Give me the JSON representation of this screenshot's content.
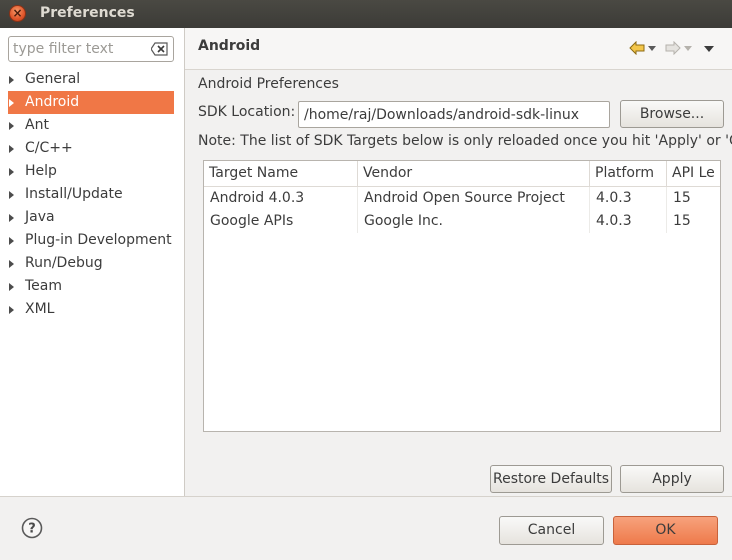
{
  "window": {
    "title": "Preferences"
  },
  "sidebar": {
    "filter_placeholder": "type filter text",
    "items": [
      {
        "label": "General"
      },
      {
        "label": "Android",
        "selected": true
      },
      {
        "label": "Ant"
      },
      {
        "label": "C/C++"
      },
      {
        "label": "Help"
      },
      {
        "label": "Install/Update"
      },
      {
        "label": "Java"
      },
      {
        "label": "Plug-in Development"
      },
      {
        "label": "Run/Debug"
      },
      {
        "label": "Team"
      },
      {
        "label": "XML"
      }
    ]
  },
  "page": {
    "title": "Android",
    "section_label": "Android Preferences",
    "sdk_label": "SDK Location:",
    "sdk_value": "/home/raj/Downloads/android-sdk-linux",
    "browse_label": "Browse...",
    "note": "Note: The list of SDK Targets below is only reloaded once you hit 'Apply' or 'OK'.",
    "table": {
      "headers": [
        "Target Name",
        "Vendor",
        "Platform",
        "API Le"
      ],
      "rows": [
        [
          "Android 4.0.3",
          "Android Open Source Project",
          "4.0.3",
          "15"
        ],
        [
          "Google APIs",
          "Google Inc.",
          "4.0.3",
          "15"
        ]
      ]
    },
    "restore_label": "Restore Defaults",
    "apply_label": "Apply"
  },
  "footer": {
    "cancel_label": "Cancel",
    "ok_label": "OK"
  },
  "colors": {
    "accent": "#f07746",
    "titlebar": "#3c3b37"
  }
}
